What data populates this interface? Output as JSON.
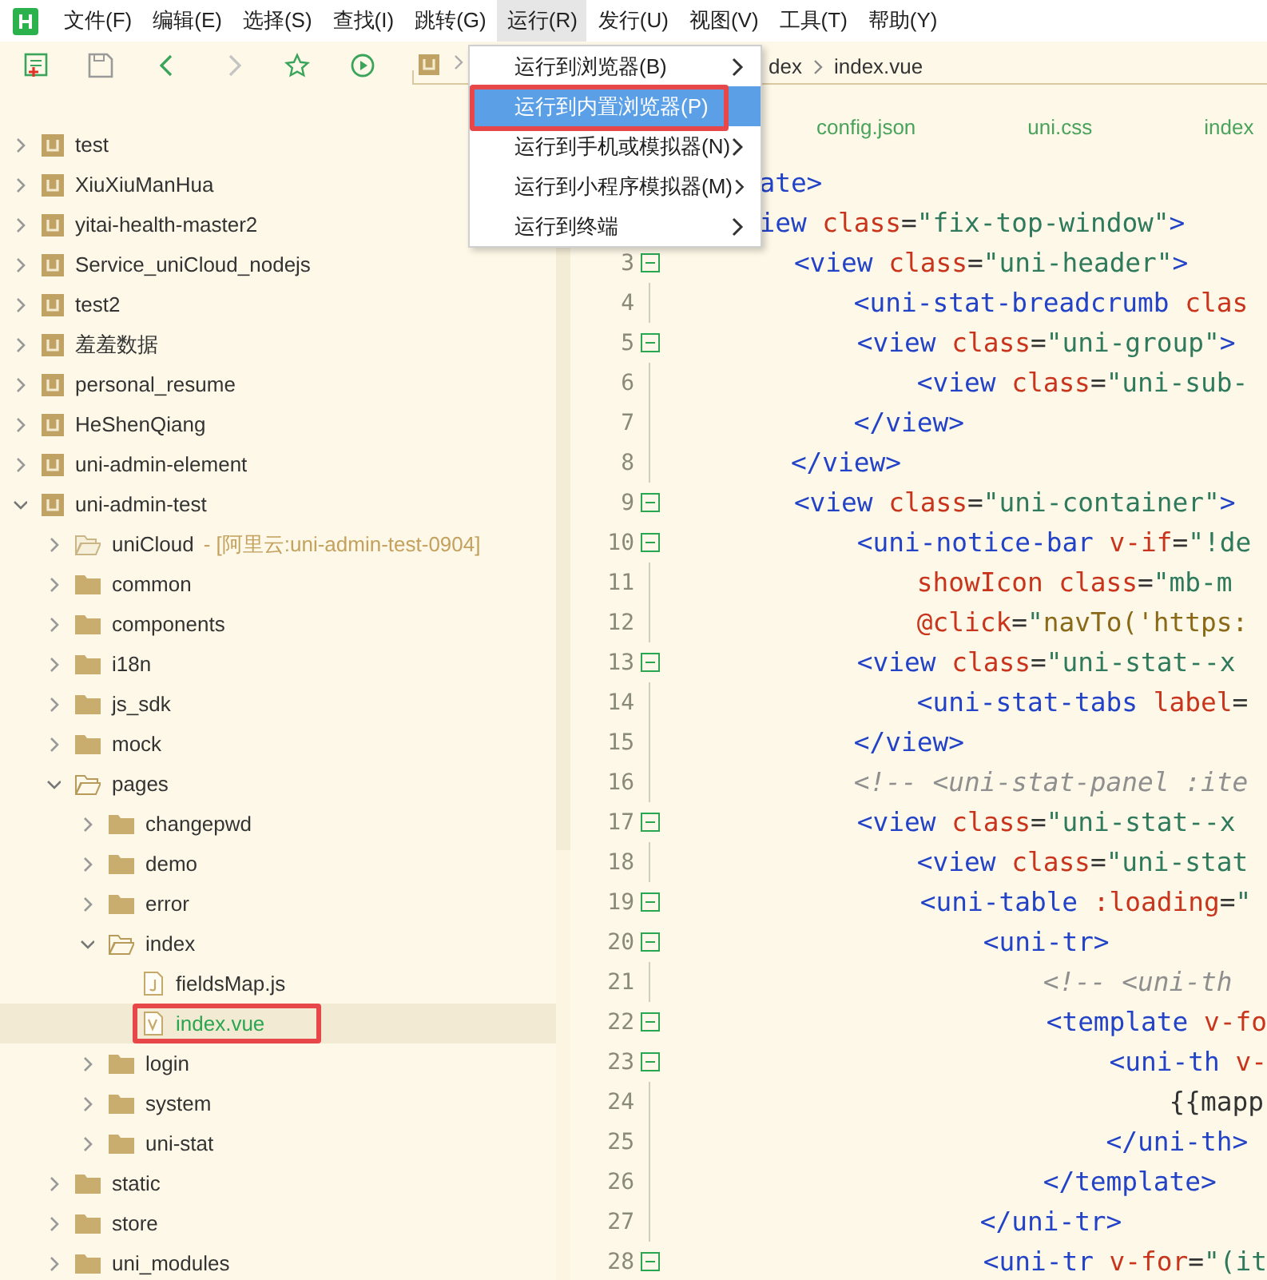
{
  "menubar": {
    "items": [
      {
        "label": "文件(F)",
        "selected": false
      },
      {
        "label": "编辑(E)",
        "selected": false
      },
      {
        "label": "选择(S)",
        "selected": false
      },
      {
        "label": "查找(I)",
        "selected": false
      },
      {
        "label": "跳转(G)",
        "selected": false
      },
      {
        "label": "运行(R)",
        "selected": true
      },
      {
        "label": "发行(U)",
        "selected": false
      },
      {
        "label": "视图(V)",
        "selected": false
      },
      {
        "label": "工具(T)",
        "selected": false
      },
      {
        "label": "帮助(Y)",
        "selected": false
      }
    ]
  },
  "toolbar": {
    "breadcrumb_tail": [
      "dex",
      "index.vue"
    ]
  },
  "run_menu": {
    "items": [
      {
        "label": "运行到浏览器(B)",
        "submenu": true,
        "selected": false,
        "outlined": false
      },
      {
        "label": "运行到内置浏览器(P)",
        "submenu": false,
        "selected": true,
        "outlined": true
      },
      {
        "label": "运行到手机或模拟器(N)",
        "submenu": true,
        "selected": false,
        "outlined": false
      },
      {
        "label": "运行到小程序模拟器(M)",
        "submenu": true,
        "selected": false,
        "outlined": false
      },
      {
        "label": "运行到终端",
        "submenu": true,
        "selected": false,
        "outlined": false
      }
    ]
  },
  "sidebar": {
    "items": [
      {
        "kind": "project",
        "label": "test",
        "expanded": false,
        "selected": false
      },
      {
        "kind": "project",
        "label": "XiuXiuManHua",
        "expanded": false,
        "selected": false
      },
      {
        "kind": "project",
        "label": "yitai-health-master2",
        "expanded": false,
        "selected": false
      },
      {
        "kind": "project",
        "label": "Service_uniCloud_nodejs",
        "expanded": false,
        "selected": false
      },
      {
        "kind": "project",
        "label": "test2",
        "expanded": false,
        "selected": false
      },
      {
        "kind": "project",
        "label": "羞羞数据",
        "expanded": false,
        "selected": false
      },
      {
        "kind": "project",
        "label": "personal_resume",
        "expanded": false,
        "selected": false
      },
      {
        "kind": "project",
        "label": "HeShenQiang",
        "expanded": false,
        "selected": false
      },
      {
        "kind": "project",
        "label": "uni-admin-element",
        "expanded": false,
        "selected": false
      },
      {
        "kind": "project",
        "label": "uni-admin-test",
        "expanded": true,
        "selected": false,
        "children": [
          {
            "kind": "cloud-folder",
            "label": "uniCloud",
            "note": "- [阿里云:uni-admin-test-0904]",
            "expanded": false,
            "selected": false
          },
          {
            "kind": "folder",
            "label": "common",
            "expanded": false,
            "selected": false
          },
          {
            "kind": "folder",
            "label": "components",
            "expanded": false,
            "selected": false
          },
          {
            "kind": "folder",
            "label": "i18n",
            "expanded": false,
            "selected": false
          },
          {
            "kind": "folder",
            "label": "js_sdk",
            "expanded": false,
            "selected": false
          },
          {
            "kind": "folder",
            "label": "mock",
            "expanded": false,
            "selected": false
          },
          {
            "kind": "folder",
            "label": "pages",
            "expanded": true,
            "selected": false,
            "children": [
              {
                "kind": "folder",
                "label": "changepwd",
                "expanded": false,
                "selected": false
              },
              {
                "kind": "folder",
                "label": "demo",
                "expanded": false,
                "selected": false
              },
              {
                "kind": "folder",
                "label": "error",
                "expanded": false,
                "selected": false
              },
              {
                "kind": "folder",
                "label": "index",
                "expanded": true,
                "selected": false,
                "children": [
                  {
                    "kind": "js-file",
                    "label": "fieldsMap.js",
                    "selected": false,
                    "outlined": false
                  },
                  {
                    "kind": "vue-file",
                    "label": "index.vue",
                    "selected": true,
                    "outlined": true
                  }
                ]
              },
              {
                "kind": "folder",
                "label": "login",
                "expanded": false,
                "selected": false
              },
              {
                "kind": "folder",
                "label": "system",
                "expanded": false,
                "selected": false
              },
              {
                "kind": "folder",
                "label": "uni-stat",
                "expanded": false,
                "selected": false
              }
            ]
          },
          {
            "kind": "folder",
            "label": "static",
            "expanded": false,
            "selected": false
          },
          {
            "kind": "folder",
            "label": "store",
            "expanded": false,
            "selected": false
          },
          {
            "kind": "folder",
            "label": "uni_modules",
            "expanded": false,
            "selected": false
          }
        ]
      }
    ]
  },
  "editor": {
    "tabs": [
      "config.json",
      "uni.css",
      "index"
    ],
    "lines": [
      {
        "foldable": false,
        "tokens": [
          {
            "kind": "tag",
            "text": "      ate>"
          }
        ]
      },
      {
        "foldable": false,
        "tokens": [
          {
            "kind": "tag",
            "text": "      iew"
          },
          {
            "kind": "attr",
            "text": " class"
          },
          {
            "kind": "plain",
            "text": "="
          },
          {
            "kind": "string",
            "text": "\"fix-top-window\""
          },
          {
            "kind": "tag",
            "text": ">"
          }
        ]
      },
      {
        "number": "3",
        "foldable": true,
        "tokens": [
          {
            "kind": "tag",
            "text": "        <view"
          },
          {
            "kind": "attr",
            "text": " class"
          },
          {
            "kind": "plain",
            "text": "="
          },
          {
            "kind": "string",
            "text": "\"uni-header\""
          },
          {
            "kind": "tag",
            "text": ">"
          }
        ]
      },
      {
        "number": "4",
        "foldable": false,
        "tokens": [
          {
            "kind": "tag",
            "text": "            <uni-stat-breadcrumb"
          },
          {
            "kind": "attr",
            "text": " clas"
          }
        ]
      },
      {
        "number": "5",
        "foldable": true,
        "tokens": [
          {
            "kind": "tag",
            "text": "            <view"
          },
          {
            "kind": "attr",
            "text": " class"
          },
          {
            "kind": "plain",
            "text": "="
          },
          {
            "kind": "string",
            "text": "\"uni-group\""
          },
          {
            "kind": "tag",
            "text": ">"
          }
        ]
      },
      {
        "number": "6",
        "foldable": false,
        "tokens": [
          {
            "kind": "tag",
            "text": "                <view"
          },
          {
            "kind": "attr",
            "text": " class"
          },
          {
            "kind": "plain",
            "text": "="
          },
          {
            "kind": "string",
            "text": "\"uni-sub-"
          }
        ]
      },
      {
        "number": "7",
        "foldable": false,
        "tokens": [
          {
            "kind": "tag",
            "text": "            </view>"
          }
        ]
      },
      {
        "number": "8",
        "foldable": false,
        "tokens": [
          {
            "kind": "tag",
            "text": "        </view>"
          }
        ]
      },
      {
        "number": "9",
        "foldable": true,
        "tokens": [
          {
            "kind": "tag",
            "text": "        <view"
          },
          {
            "kind": "attr",
            "text": " class"
          },
          {
            "kind": "plain",
            "text": "="
          },
          {
            "kind": "string",
            "text": "\"uni-container\""
          },
          {
            "kind": "tag",
            "text": ">"
          }
        ]
      },
      {
        "number": "10",
        "foldable": true,
        "tokens": [
          {
            "kind": "tag",
            "text": "            <uni-notice-bar"
          },
          {
            "kind": "attr",
            "text": " v-if"
          },
          {
            "kind": "plain",
            "text": "="
          },
          {
            "kind": "string",
            "text": "\"!de"
          }
        ]
      },
      {
        "number": "11",
        "foldable": false,
        "tokens": [
          {
            "kind": "attr",
            "text": "                showIcon class"
          },
          {
            "kind": "plain",
            "text": "="
          },
          {
            "kind": "string",
            "text": "\"mb-m"
          }
        ]
      },
      {
        "number": "12",
        "foldable": false,
        "tokens": [
          {
            "kind": "attr",
            "text": "                @click"
          },
          {
            "kind": "plain",
            "text": "="
          },
          {
            "kind": "string",
            "text": "\""
          },
          {
            "kind": "expr",
            "text": "navTo('https:"
          }
        ]
      },
      {
        "number": "13",
        "foldable": true,
        "tokens": [
          {
            "kind": "tag",
            "text": "            <view"
          },
          {
            "kind": "attr",
            "text": " class"
          },
          {
            "kind": "plain",
            "text": "="
          },
          {
            "kind": "string",
            "text": "\"uni-stat--x"
          }
        ]
      },
      {
        "number": "14",
        "foldable": false,
        "tokens": [
          {
            "kind": "tag",
            "text": "                <uni-stat-tabs"
          },
          {
            "kind": "attr",
            "text": " label"
          },
          {
            "kind": "plain",
            "text": "="
          }
        ]
      },
      {
        "number": "15",
        "foldable": false,
        "tokens": [
          {
            "kind": "tag",
            "text": "            </view>"
          }
        ]
      },
      {
        "number": "16",
        "foldable": false,
        "tokens": [
          {
            "kind": "comment",
            "text": "            <!-- <uni-stat-panel :ite"
          }
        ]
      },
      {
        "number": "17",
        "foldable": true,
        "tokens": [
          {
            "kind": "tag",
            "text": "            <view"
          },
          {
            "kind": "attr",
            "text": " class"
          },
          {
            "kind": "plain",
            "text": "="
          },
          {
            "kind": "string",
            "text": "\"uni-stat--x"
          }
        ]
      },
      {
        "number": "18",
        "foldable": false,
        "tokens": [
          {
            "kind": "tag",
            "text": "                <view"
          },
          {
            "kind": "attr",
            "text": " class"
          },
          {
            "kind": "plain",
            "text": "="
          },
          {
            "kind": "string",
            "text": "\"uni-stat"
          }
        ]
      },
      {
        "number": "19",
        "foldable": true,
        "tokens": [
          {
            "kind": "tag",
            "text": "                <uni-table"
          },
          {
            "kind": "attr",
            "text": " :loading"
          },
          {
            "kind": "plain",
            "text": "="
          },
          {
            "kind": "string",
            "text": "\""
          }
        ]
      },
      {
        "number": "20",
        "foldable": true,
        "tokens": [
          {
            "kind": "tag",
            "text": "                    <uni-tr>"
          }
        ]
      },
      {
        "number": "21",
        "foldable": false,
        "tokens": [
          {
            "kind": "comment",
            "text": "                        <!-- <uni-th"
          }
        ]
      },
      {
        "number": "22",
        "foldable": true,
        "tokens": [
          {
            "kind": "tag",
            "text": "                        <template"
          },
          {
            "kind": "attr",
            "text": " v-fo"
          }
        ]
      },
      {
        "number": "23",
        "foldable": true,
        "tokens": [
          {
            "kind": "tag",
            "text": "                            <uni-th"
          },
          {
            "kind": "attr",
            "text": " v-"
          }
        ]
      },
      {
        "number": "24",
        "foldable": false,
        "tokens": [
          {
            "kind": "plain",
            "text": "                                {{mapp"
          }
        ]
      },
      {
        "number": "25",
        "foldable": false,
        "tokens": [
          {
            "kind": "tag",
            "text": "                            </uni-th>"
          }
        ]
      },
      {
        "number": "26",
        "foldable": false,
        "tokens": [
          {
            "kind": "tag",
            "text": "                        </template>"
          }
        ]
      },
      {
        "number": "27",
        "foldable": false,
        "tokens": [
          {
            "kind": "tag",
            "text": "                    </uni-tr>"
          }
        ]
      },
      {
        "number": "28",
        "foldable": true,
        "tokens": [
          {
            "kind": "tag",
            "text": "                    <uni-tr"
          },
          {
            "kind": "attr",
            "text": " v-for"
          },
          {
            "kind": "plain",
            "text": "="
          },
          {
            "kind": "string",
            "text": "\"(it"
          }
        ]
      }
    ]
  }
}
